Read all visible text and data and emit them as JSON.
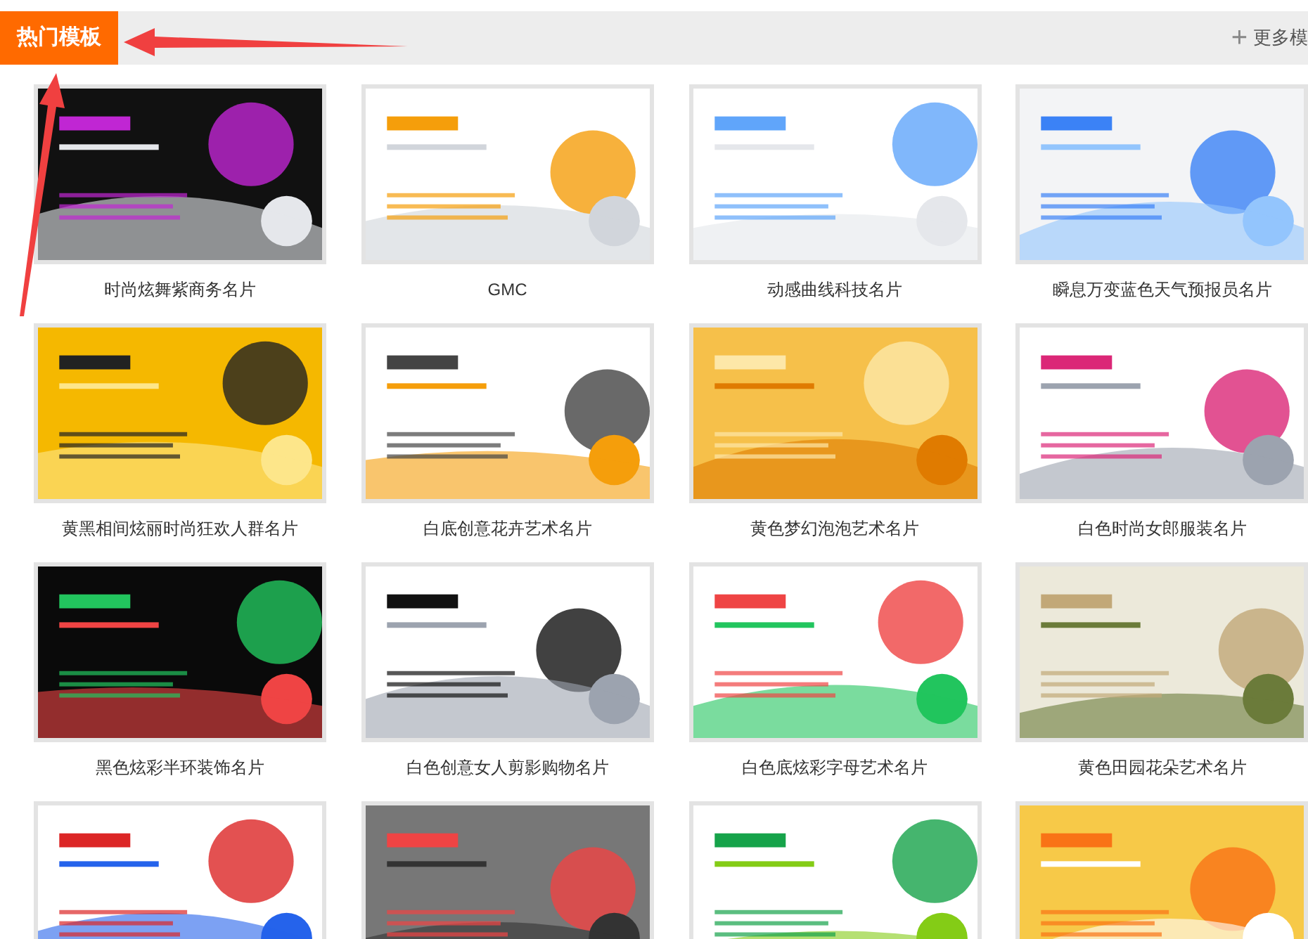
{
  "header": {
    "tab": "热门模板",
    "more_link": {
      "icon": "+",
      "label": "更多模"
    }
  },
  "templates": [
    {
      "kind": "picture",
      "caption": "时尚炫舞紫商务名片"
    },
    {
      "kind": "picture",
      "caption": "GMC"
    },
    {
      "kind": "picture",
      "caption": "动感曲线科技名片"
    },
    {
      "kind": "picture",
      "caption": "瞬息万变蓝色天气预报员名片"
    },
    {
      "kind": "picture",
      "caption": "黄黑相间炫丽时尚狂欢人群名片"
    },
    {
      "kind": "picture",
      "caption": "白底创意花卉艺术名片"
    },
    {
      "kind": "picture",
      "caption": "黄色梦幻泡泡艺术名片"
    },
    {
      "kind": "picture",
      "caption": "白色时尚女郎服装名片"
    },
    {
      "kind": "picture",
      "caption": "黑色炫彩半环装饰名片"
    },
    {
      "kind": "picture",
      "caption": "白色创意女人剪影购物名片"
    },
    {
      "kind": "picture",
      "caption": "白色底炫彩字母艺术名片"
    },
    {
      "kind": "picture",
      "caption": "黄色田园花朵艺术名片"
    },
    {
      "kind": "picture"
    },
    {
      "kind": "picture"
    },
    {
      "kind": "picture"
    },
    {
      "kind": "picture"
    }
  ]
}
